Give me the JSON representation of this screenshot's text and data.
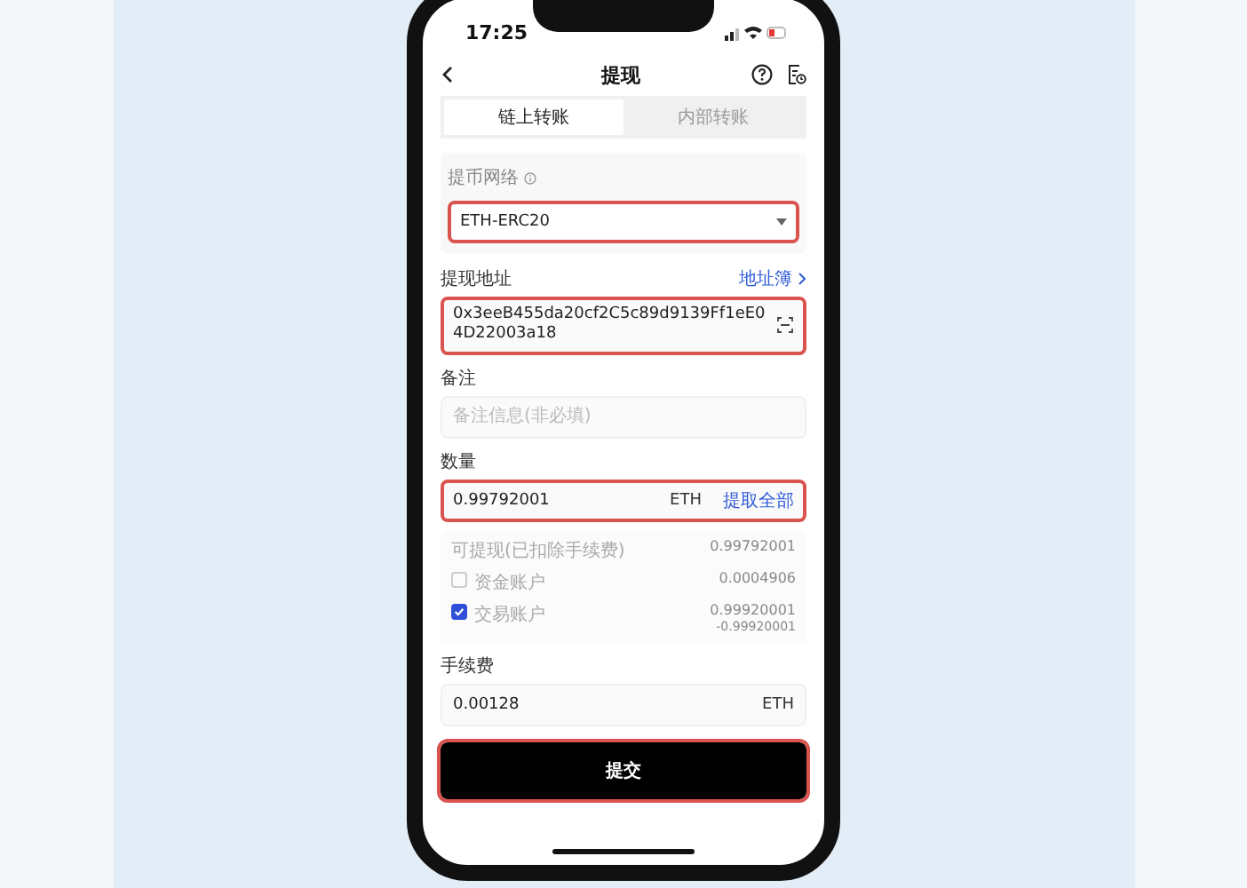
{
  "status_bar": {
    "time": "17:25"
  },
  "header": {
    "title": "提现"
  },
  "tabs": [
    {
      "label": "链上转账",
      "selected": true
    },
    {
      "label": "内部转账",
      "selected": false
    }
  ],
  "network": {
    "label": "提币网络",
    "value": "ETH-ERC20",
    "highlighted": true
  },
  "address": {
    "label": "提现地址",
    "link": "地址簿",
    "value": "0x3eeB455da20cf2C5c89d9139Ff1eE04D22003a18",
    "highlighted": true
  },
  "remark": {
    "label": "备注",
    "placeholder": "备注信息(非必填)",
    "highlighted": false
  },
  "amount": {
    "label": "数量",
    "value": "0.99792001",
    "unit": "ETH",
    "action": "提取全部",
    "highlighted": true
  },
  "balances": {
    "available_label": "可提现(已扣除手续费)",
    "available_value": "0.99792001",
    "accounts": [
      {
        "label": "资金账户",
        "value": "0.0004906",
        "checked": false
      },
      {
        "label": "交易账户",
        "value": "0.99920001",
        "deduction": "-0.99920001",
        "checked": true
      }
    ]
  },
  "fee": {
    "label": "手续费",
    "value": "0.00128",
    "unit": "ETH"
  },
  "submit": {
    "label": "提交",
    "highlighted": true
  }
}
